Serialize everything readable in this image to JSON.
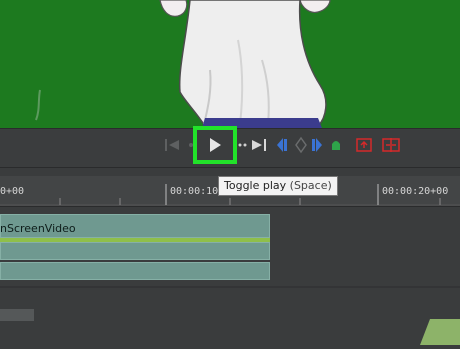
{
  "toolbar": {
    "play_tooltip_label": "Toggle play",
    "play_tooltip_shortcut": "(Space)"
  },
  "ruler": {
    "labels": [
      "0+00",
      "00:00:10+00",
      "00:00:20+00"
    ]
  },
  "timeline": {
    "clip_title": "nScreenVideo"
  },
  "colors": {
    "highlight": "#22e22a",
    "preview_green": "#1d7a1f",
    "clip": "#6f9990",
    "accent_blue": "#3a73d4",
    "accent_red": "#d52a2a"
  }
}
